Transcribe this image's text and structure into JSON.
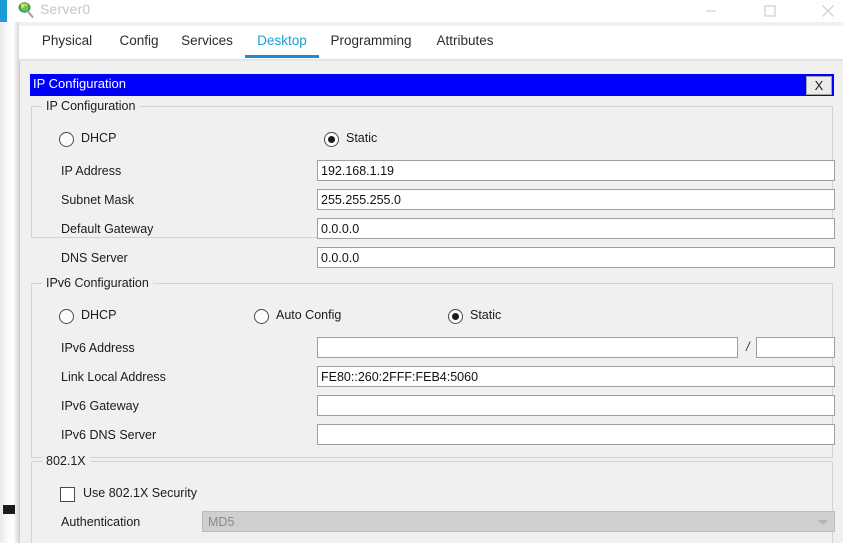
{
  "window": {
    "title": "Server0",
    "icon": "server-device-icon",
    "controls": {
      "minimize": "minimize-icon",
      "maximize": "maximize-icon",
      "close": "close-icon"
    }
  },
  "tabs": [
    {
      "label": "Physical",
      "active": false
    },
    {
      "label": "Config",
      "active": false
    },
    {
      "label": "Services",
      "active": false
    },
    {
      "label": "Desktop",
      "active": true
    },
    {
      "label": "Programming",
      "active": false
    },
    {
      "label": "Attributes",
      "active": false
    }
  ],
  "dialog": {
    "title": "IP Configuration",
    "close_label": "X"
  },
  "ipv4": {
    "legend": "IP Configuration",
    "mode_options": [
      {
        "label": "DHCP",
        "selected": false
      },
      {
        "label": "Static",
        "selected": true
      }
    ],
    "fields": [
      {
        "label": "IP Address",
        "value": "192.168.1.19",
        "placeholder": ""
      },
      {
        "label": "Subnet Mask",
        "value": "255.255.255.0",
        "placeholder": ""
      },
      {
        "label": "Default Gateway",
        "value": "0.0.0.0",
        "placeholder": ""
      },
      {
        "label": "DNS Server",
        "value": "0.0.0.0",
        "placeholder": ""
      }
    ]
  },
  "ipv6": {
    "legend": "IPv6 Configuration",
    "mode_options": [
      {
        "label": "DHCP",
        "selected": false
      },
      {
        "label": "Auto Config",
        "selected": false
      },
      {
        "label": "Static",
        "selected": true
      }
    ],
    "address_label": "IPv6 Address",
    "address_value": "",
    "prefix_separator": "/",
    "prefix_value": "",
    "fields": [
      {
        "label": "Link Local Address",
        "value": "FE80::260:2FFF:FEB4:5060"
      },
      {
        "label": "IPv6 Gateway",
        "value": ""
      },
      {
        "label": "IPv6 DNS Server",
        "value": ""
      }
    ]
  },
  "dot1x": {
    "legend": "802.1X",
    "checkbox_label": "Use 802.1X Security",
    "checkbox_checked": false,
    "auth_label": "Authentication",
    "auth_value": "MD5",
    "auth_enabled": false
  },
  "colors": {
    "dialog_title_bg": "#0000fe",
    "tab_active": "#1a9fd4",
    "tab_underline": "#1a8ed4",
    "panel_bg": "#f0f0f0",
    "field_border": "#9e9e9e",
    "disabled_bg": "#cfcfcf"
  }
}
